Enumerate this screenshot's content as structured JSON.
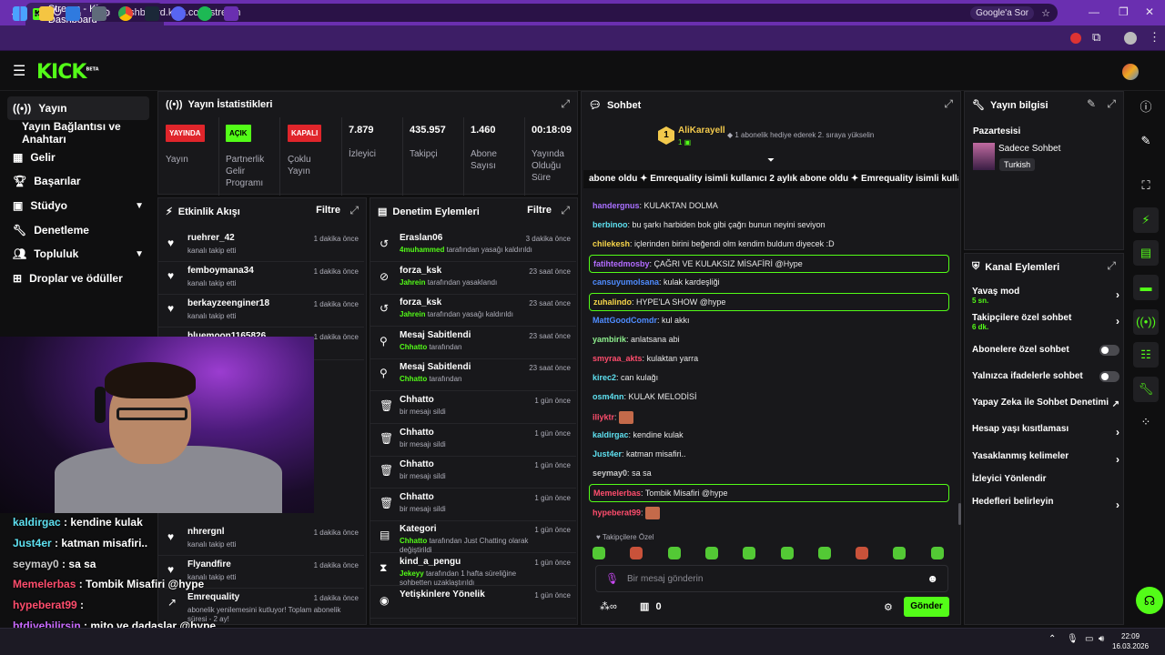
{
  "browser": {
    "tab_title": "Stream - Kick Dashboard",
    "url": "dashboard.kick.com/stream",
    "google_search": "Google'a Sor"
  },
  "brand": {
    "logo": "KICK",
    "beta": "BETA",
    "accent": "#53fc18"
  },
  "nav": {
    "items": [
      {
        "label": "Yayın",
        "icon": "broadcast-icon"
      },
      {
        "label": "Yayın Bağlantısı ve Anahtarı"
      },
      {
        "label": "Gelir",
        "icon": "revenue-icon"
      },
      {
        "label": "Başarılar",
        "icon": "trophy-icon"
      },
      {
        "label": "Stüdyo",
        "icon": "studio-icon"
      },
      {
        "label": "Denetleme",
        "icon": "wrench-icon"
      },
      {
        "label": "Topluluk",
        "icon": "community-icon"
      },
      {
        "label": "Droplar ve ödüller",
        "icon": "drops-icon"
      }
    ]
  },
  "stats": {
    "title": "Yayın İstatistikleri",
    "items": [
      {
        "badge": "YAYINDA",
        "label": "Yayın"
      },
      {
        "badge": "AÇIK",
        "label": "Partnerlik Gelir Programı"
      },
      {
        "badge": "KAPALI",
        "label": "Çoklu Yayın"
      },
      {
        "value": "7.879",
        "label": "İzleyici"
      },
      {
        "value": "435.957",
        "label": "Takipçi"
      },
      {
        "value": "1.460",
        "label": "Abone Sayısı"
      },
      {
        "value": "00:18:09",
        "label": "Yayında Olduğu Süre"
      }
    ]
  },
  "activity": {
    "title": "Etkinlik Akışı",
    "filter": "Filtre",
    "rows": [
      {
        "name": "ruehrer_42",
        "sub": "kanalı takip etti",
        "time": "1 dakika önce"
      },
      {
        "name": "femboymana34",
        "sub": "kanalı takip etti",
        "time": "1 dakika önce"
      },
      {
        "name": "berkayzeenginer18",
        "sub": "kanalı takip etti",
        "time": "1 dakika önce"
      },
      {
        "name": "bluemoon1165826",
        "sub": "",
        "time": "1 dakika önce"
      },
      {
        "name": "nhrergnl",
        "sub": "kanalı takip etti",
        "time": "1 dakika önce"
      },
      {
        "name": "Flyandfire",
        "sub": "kanalı takip etti",
        "time": "1 dakika önce"
      },
      {
        "name": "Emrequality",
        "sub": "abonelik yenilemesini kutluyor! Toplam abonelik süresi - 2 ay!",
        "time": "1 dakika önce"
      }
    ]
  },
  "moderation": {
    "title": "Denetim Eylemleri",
    "filter": "Filtre",
    "rows": [
      {
        "name": "Eraslan06",
        "actor": "4muhammed",
        "sub": "tarafından yasağı kaldırıldı",
        "time": "3 dakika önce",
        "icon": "undo-icon"
      },
      {
        "name": "forza_ksk",
        "actor": "Jahrein",
        "sub": "tarafından yasaklandı",
        "time": "23 saat önce",
        "icon": "ban-icon"
      },
      {
        "name": "forza_ksk",
        "actor": "Jahrein",
        "sub": "tarafından yasağı kaldırıldı",
        "time": "23 saat önce",
        "icon": "undo-icon"
      },
      {
        "name": "Mesaj Sabitlendi",
        "actor": "Chhatto",
        "sub": "tarafından",
        "time": "23 saat önce",
        "icon": "pin-icon"
      },
      {
        "name": "Mesaj Sabitlendi",
        "actor": "Chhatto",
        "sub": "tarafından",
        "time": "23 saat önce",
        "icon": "pin-icon"
      },
      {
        "name": "Chhatto",
        "actor": "",
        "sub": "bir mesajı sildi",
        "time": "1 gün önce",
        "icon": "trash-icon"
      },
      {
        "name": "Chhatto",
        "actor": "",
        "sub": "bir mesajı sildi",
        "time": "1 gün önce",
        "icon": "trash-icon"
      },
      {
        "name": "Chhatto",
        "actor": "",
        "sub": "bir mesajı sildi",
        "time": "1 gün önce",
        "icon": "trash-icon"
      },
      {
        "name": "Chhatto",
        "actor": "",
        "sub": "bir mesajı sildi",
        "time": "1 gün önce",
        "icon": "trash-icon"
      },
      {
        "name": "Kategori",
        "actor": "Chhatto",
        "sub": "tarafından Just Chatting olarak değiştirildi",
        "time": "1 gün önce",
        "icon": "category-icon"
      },
      {
        "name": "kind_a_pengu",
        "actor": "Jekeyy",
        "sub": "tarafından 1 hafta süreliğine sohbetten uzaklaştırıldı",
        "time": "1 gün önce",
        "icon": "hourglass-icon"
      },
      {
        "name": "Yetişkinlere Yönelik",
        "actor": "",
        "sub": "",
        "time": "1 gün önce",
        "icon": "eye-icon"
      }
    ]
  },
  "chat": {
    "title": "Sohbet",
    "pinned_user": "AliKarayell",
    "pinned_count": "1",
    "gift_text": "1 abonelik hediye ederek 2. sıraya yükselin",
    "ticker": "abone oldu  ✦  Emrequality isimli kullanıcı 2 aylık abone oldu  ✦  Emrequality isimli kulla",
    "messages": [
      {
        "user": "handergnus",
        "color": "#a970ff",
        "text": "KULAKTAN DOLMA"
      },
      {
        "user": "berbinoo",
        "color": "#5ee0f0",
        "text": "bu şarkı harbiden bok gibi çağrı bunun neyini seviyon"
      },
      {
        "user": "chilekesh",
        "color": "#f7d54a",
        "text": "içlerinden birini beğendi olm kendim buldum diyecek :D"
      },
      {
        "user": "fatihtedmosby",
        "color": "#b36bff",
        "text": "ÇAĞRI VE KULAKSIZ MİSAFİRİ @Hype",
        "highlight": true
      },
      {
        "user": "cansuyumolsana",
        "color": "#4f8cff",
        "text": "kulak kardeşliği"
      },
      {
        "user": "zuhalindo",
        "color": "#f7d54a",
        "text": "HYPE'LA SHOW @hype",
        "highlight": true
      },
      {
        "user": "MattGoodComdr",
        "color": "#4f8cff",
        "text": "kul akkı"
      },
      {
        "user": "yambirik",
        "color": "#8ef08e",
        "text": "anlatsana abi"
      },
      {
        "user": "smyraa_akts",
        "color": "#ff4d6d",
        "text": "kulaktan yarra"
      },
      {
        "user": "kirec2",
        "color": "#5ee0f0",
        "text": "can kulağı"
      },
      {
        "user": "osm4nn",
        "color": "#5ee0f0",
        "text": "KULAK MELODİSİ"
      },
      {
        "user": "iliyktr",
        "color": "#ff4d6d",
        "text": ""
      },
      {
        "user": "kaldirgac",
        "color": "#5ee0f0",
        "text": "kendine kulak"
      },
      {
        "user": "Just4er",
        "color": "#5ee0f0",
        "text": "katman misafiri.."
      },
      {
        "user": "seymay0",
        "color": "#c8c8c8",
        "text": "sa sa"
      },
      {
        "user": "Memelerbas",
        "color": "#ff4d6d",
        "text": "Tombik Misafiri @hype",
        "highlight": true
      },
      {
        "user": "hypeberat99",
        "color": "#ff4d6d",
        "text": ""
      }
    ],
    "followers_only": "Takipçilere Özel",
    "input_placeholder": "Bir mesaj gönderin",
    "points": "0",
    "send": "Gönder"
  },
  "stream_info": {
    "title": "Yayın bilgisi",
    "day": "Pazartesisi",
    "category": "Sadece Sohbet",
    "language": "Turkish"
  },
  "channel_actions": {
    "title": "Kanal Eylemleri",
    "items": [
      {
        "label": "Yavaş mod",
        "sub": "5 sn."
      },
      {
        "label": "Takipçilere özel sohbet",
        "sub": "6 dk."
      },
      {
        "label": "Abonelere özel sohbet"
      },
      {
        "label": "Yalnızca ifadelerle sohbet"
      },
      {
        "label": "Yapay Zeka ile Sohbet Denetimi"
      },
      {
        "label": "Hesap yaşı kısıtlaması"
      },
      {
        "label": "Yasaklanmış kelimeler"
      },
      {
        "label": "İzleyici Yönlendir"
      },
      {
        "label": "Hedefleri belirleyin"
      }
    ]
  },
  "overlay_chat": [
    {
      "user": "kaldirgac",
      "text": "kendine kulak",
      "color": "#5ee0f0"
    },
    {
      "user": "Just4er",
      "text": "katman misafiri..",
      "color": "#5ee0f0"
    },
    {
      "user": "seymay0",
      "text": "sa sa",
      "color": "#c8c8c8"
    },
    {
      "user": "Memelerbas",
      "text": "Tombik Misafiri @hype",
      "color": "#ff4d6d"
    },
    {
      "user": "hypeberat99",
      "text": "",
      "color": "#ff4d6d"
    },
    {
      "user": "btdiyebilirsin",
      "text": "mito ve dadaşlar @hype",
      "color": "#c96bff"
    }
  ],
  "clock": {
    "time": "22:09",
    "date": "16.03.2026"
  }
}
